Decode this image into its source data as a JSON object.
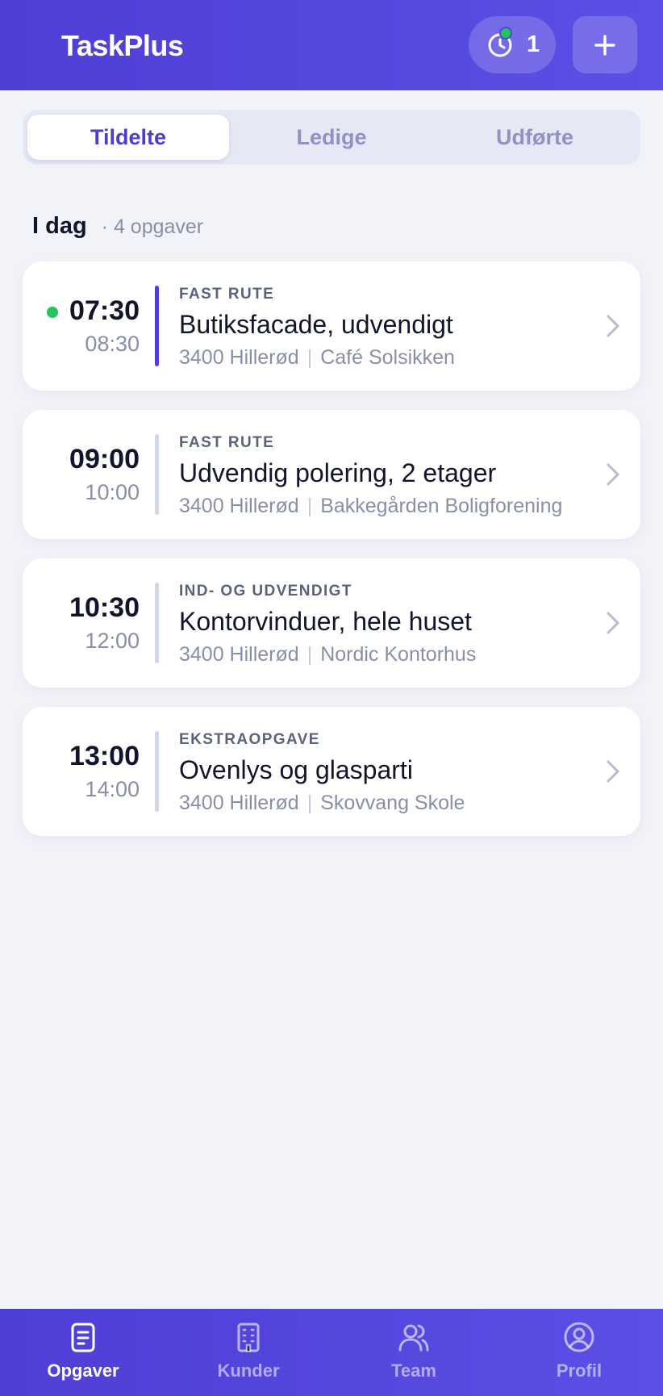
{
  "header": {
    "title": "TaskPlus",
    "timer_count": "1",
    "timer_icon": "clock-icon",
    "add_icon": "plus-icon"
  },
  "tabs": [
    {
      "label": "Tildelte",
      "active": true
    },
    {
      "label": "Ledige",
      "active": false
    },
    {
      "label": "Udførte",
      "active": false
    }
  ],
  "section": {
    "title": "I dag",
    "count": "· 4 opgaver"
  },
  "tasks": [
    {
      "start": "07:30",
      "end": "08:30",
      "category": "FAST RUTE",
      "title": "Butiksfacade, udvendigt",
      "city": "3400 Hillerød",
      "customer": "Café Solsikken",
      "live": true
    },
    {
      "start": "09:00",
      "end": "10:00",
      "category": "FAST RUTE",
      "title": "Udvendig polering, 2 etager",
      "city": "3400 Hillerød",
      "customer": "Bakkegården Boligforening",
      "live": false
    },
    {
      "start": "10:30",
      "end": "12:00",
      "category": "IND- OG UDVENDIGT",
      "title": "Kontorvinduer, hele huset",
      "city": "3400 Hillerød",
      "customer": "Nordic Kontorhus",
      "live": false
    },
    {
      "start": "13:00",
      "end": "14:00",
      "category": "EKSTRAOPGAVE",
      "title": "Ovenlys og glasparti",
      "city": "3400 Hillerød",
      "customer": "Skovvang Skole",
      "live": false
    }
  ],
  "nav": [
    {
      "label": "Opgaver",
      "icon": "clipboard-icon",
      "active": true
    },
    {
      "label": "Kunder",
      "icon": "building-icon",
      "active": false
    },
    {
      "label": "Team",
      "icon": "users-icon",
      "active": false
    },
    {
      "label": "Profil",
      "icon": "user-circle-icon",
      "active": false
    }
  ],
  "colors": {
    "brand": "#4e3fd6",
    "live": "#22c55e",
    "background": "#f2f3f9"
  }
}
